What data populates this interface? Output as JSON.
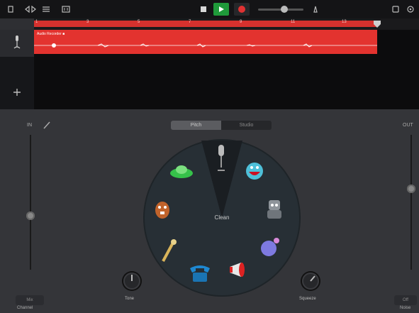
{
  "timeline": {
    "markers": [
      "1",
      "3",
      "5",
      "7",
      "9",
      "11",
      "13"
    ],
    "region_name": "Audio Recorder ■"
  },
  "panel": {
    "in_label": "IN",
    "out_label": "OUT",
    "tabs": [
      "Pitch",
      "Studio"
    ],
    "selected_tab_index": 0,
    "center_label": "Clean",
    "voices": [
      {
        "name": "microphone-voice",
        "selected": true
      },
      {
        "name": "monster-voice",
        "selected": false
      },
      {
        "name": "robot-voice",
        "selected": false
      },
      {
        "name": "bubbles-voice",
        "selected": false
      },
      {
        "name": "megaphone-voice",
        "selected": false
      },
      {
        "name": "telephone-voice",
        "selected": false
      },
      {
        "name": "mic-stick-voice",
        "selected": false
      },
      {
        "name": "chipmunk-voice",
        "selected": false
      },
      {
        "name": "alien-ufo-voice",
        "selected": false
      }
    ],
    "knobs": {
      "tone_label": "Tone",
      "squeeze_label": "Squeeze"
    },
    "buttons": {
      "left_label": "Mix",
      "left_sub": "Channel",
      "right_label": "Off",
      "right_sub": "Noise"
    },
    "in_level": 0.4,
    "out_level": 0.6
  },
  "colors": {
    "region_red": "#e3332f",
    "play_green": "#1f9a3a",
    "record_red": "#e03232",
    "wheel_bg": "#272f35"
  }
}
